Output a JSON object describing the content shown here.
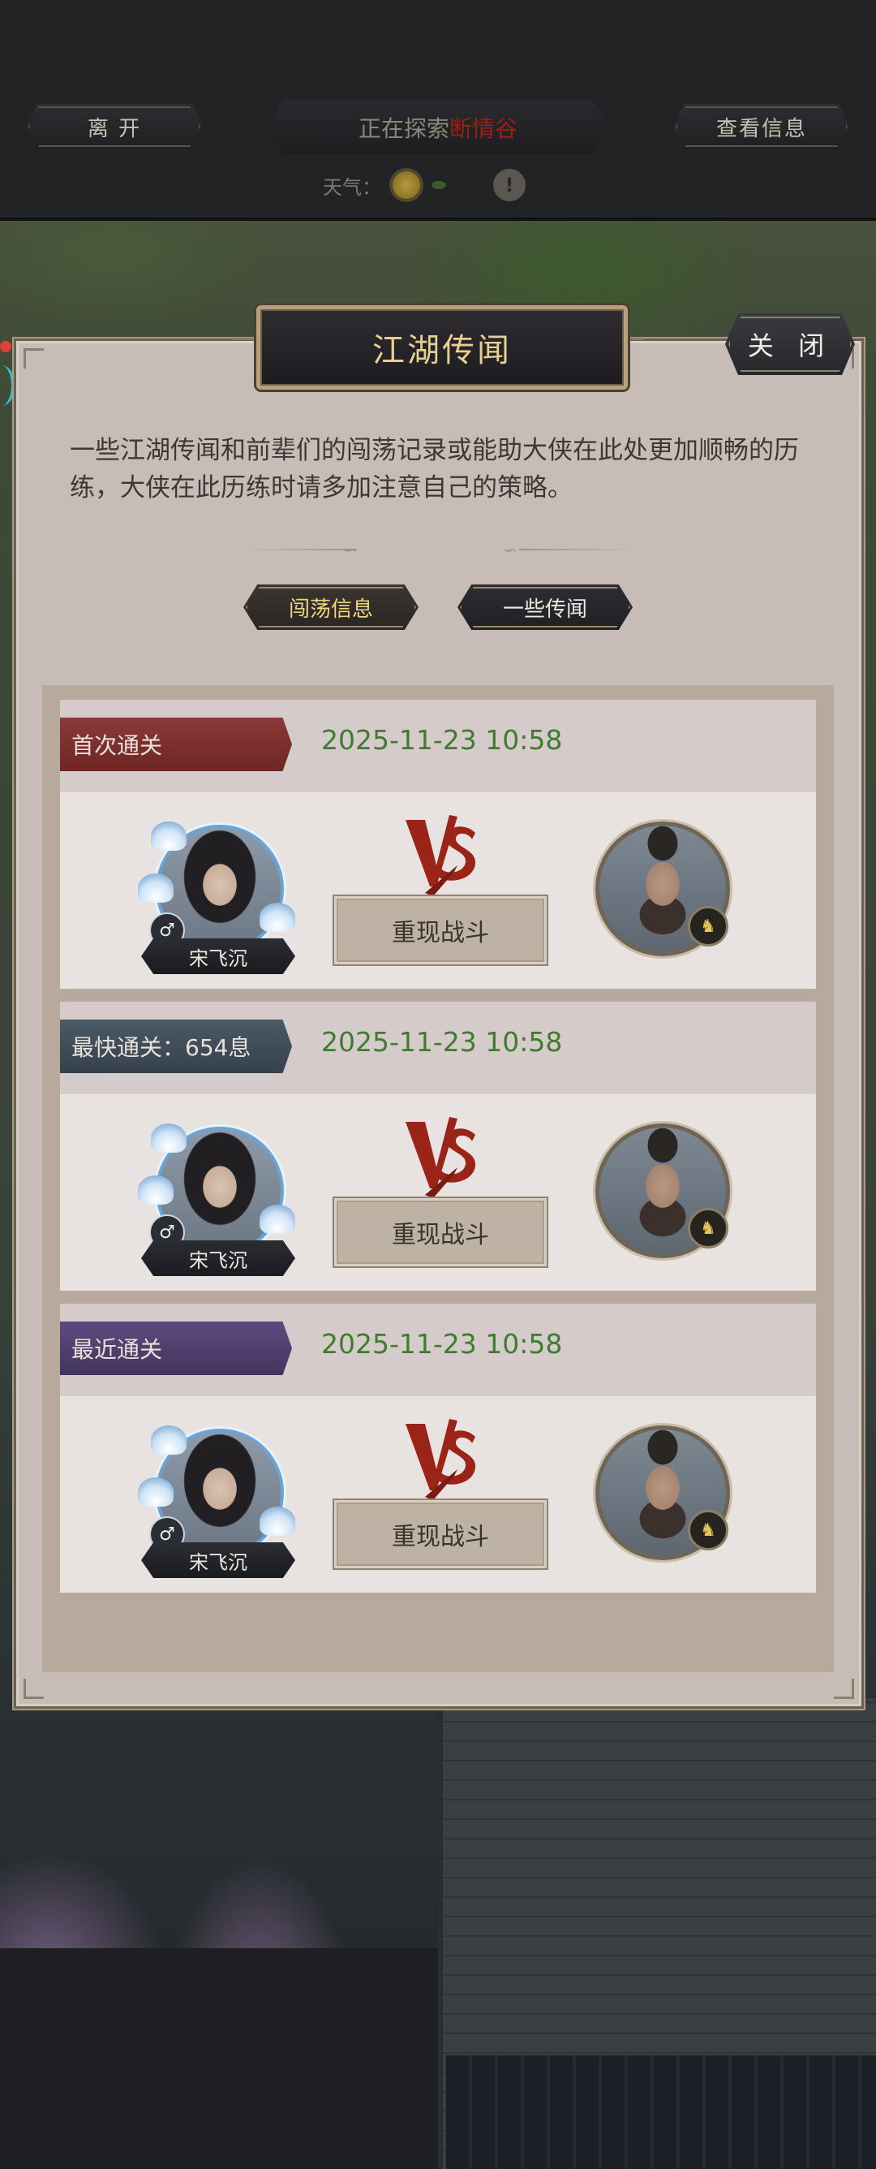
{
  "top_bar": {
    "leave_label": "离  开",
    "exploring_prefix": "正在探索",
    "location": "断情谷",
    "view_info_label": "查看信息",
    "weather_label": "天气：",
    "weather_icon": "sun-icon"
  },
  "panel": {
    "title": "江湖传闻",
    "close_label": "关 闭",
    "description": "一些江湖传闻和前辈们的闯荡记录或能助大侠在此处更加顺畅的历练，大侠在此历练时请多加注意自己的策略。",
    "tabs": [
      {
        "label": "闯荡信息",
        "active": true
      },
      {
        "label": "一些传闻",
        "active": false
      }
    ]
  },
  "records": [
    {
      "badge": "首次通关",
      "time": "2025-11-23 10:58",
      "player_name": "宋飞沉",
      "gender_symbol": "♂",
      "replay_label": "重现战斗",
      "color": "#7a2e2c"
    },
    {
      "badge": "最快通关：654息",
      "time": "2025-11-23 10:58",
      "player_name": "宋飞沉",
      "gender_symbol": "♂",
      "replay_label": "重现战斗",
      "color": "#3f4c58"
    },
    {
      "badge": "最近通关",
      "time": "2025-11-23 10:58",
      "player_name": "宋飞沉",
      "gender_symbol": "♂",
      "replay_label": "重现战斗",
      "color": "#4e3e6c"
    }
  ],
  "colors": {
    "accent_gold": "#e9cf8f",
    "time_green": "#3f7c2d",
    "location_red": "#9c1e16",
    "vs_red": "#9a2418"
  }
}
